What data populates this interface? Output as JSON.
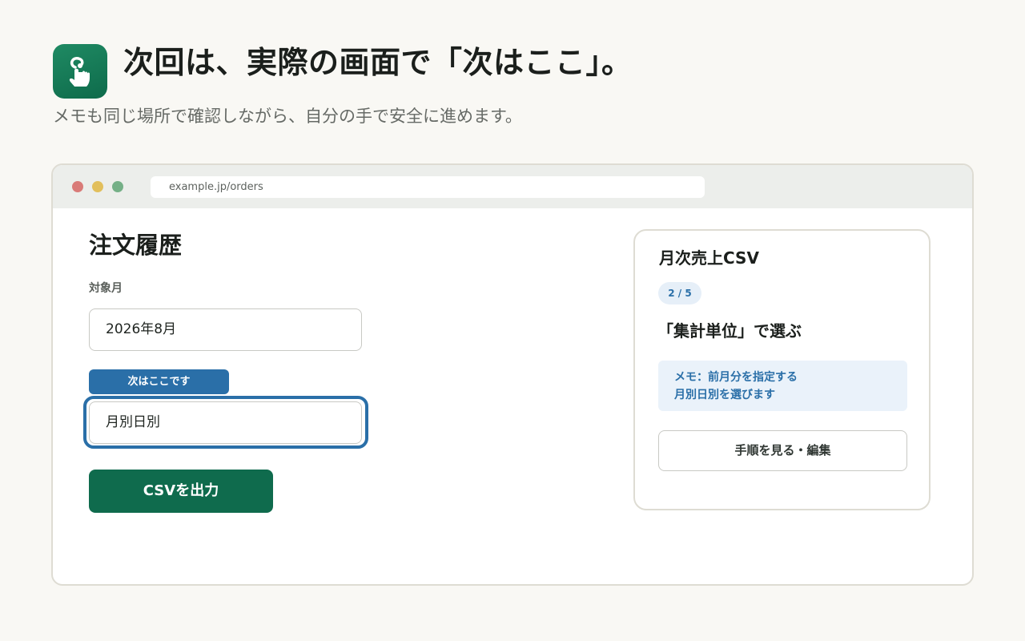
{
  "hero": {
    "icon": "tap-hand-icon",
    "title": "次回は、実際の画面で「次はここ」。",
    "subtitle": "メモも同じ場所で確認しながら、自分の手で安全に進めます。"
  },
  "browser": {
    "url": "example.jp/orders"
  },
  "page": {
    "title": "注文履歴",
    "month_label": "対象月",
    "month_value": "2026年8月",
    "next_tag": "次はここです",
    "aggregation_value": "月別日別",
    "export_button": "CSVを出力"
  },
  "panel": {
    "title": "月次売上CSV",
    "step": "2 / 5",
    "instruction": "「集計単位」で選ぶ",
    "memo_line1": "メモ：前月分を指定する",
    "memo_line2": "月別日別を選びます",
    "guide_button": "手順を見る・編集"
  },
  "colors": {
    "brand_green": "#0f6b4d",
    "highlight_blue": "#2a6fa8",
    "background": "#f9f8f4"
  }
}
